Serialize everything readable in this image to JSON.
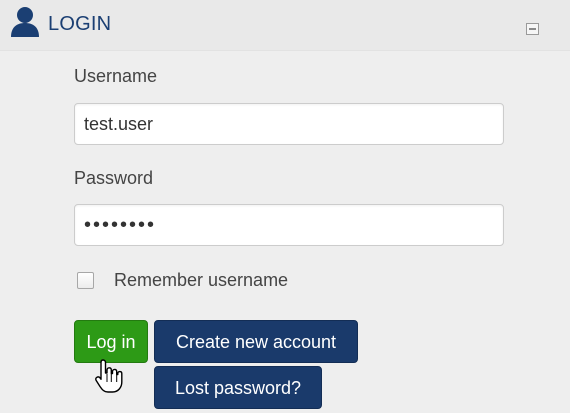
{
  "header": {
    "title": "LOGIN",
    "icon": "user-icon",
    "collapse_icon": "collapse-icon"
  },
  "form": {
    "username_label": "Username",
    "username_value": "test.user",
    "password_label": "Password",
    "password_value": "secretpw",
    "remember_label": "Remember username",
    "remember_checked": false
  },
  "buttons": {
    "login_label": "Log in",
    "create_account_label": "Create new account",
    "lost_password_label": "Lost password?"
  },
  "colors": {
    "accent": "#1b3f73",
    "login_button": "#2d9a16",
    "secondary_button": "#1a3a6b",
    "panel_background": "#eeeeee"
  }
}
